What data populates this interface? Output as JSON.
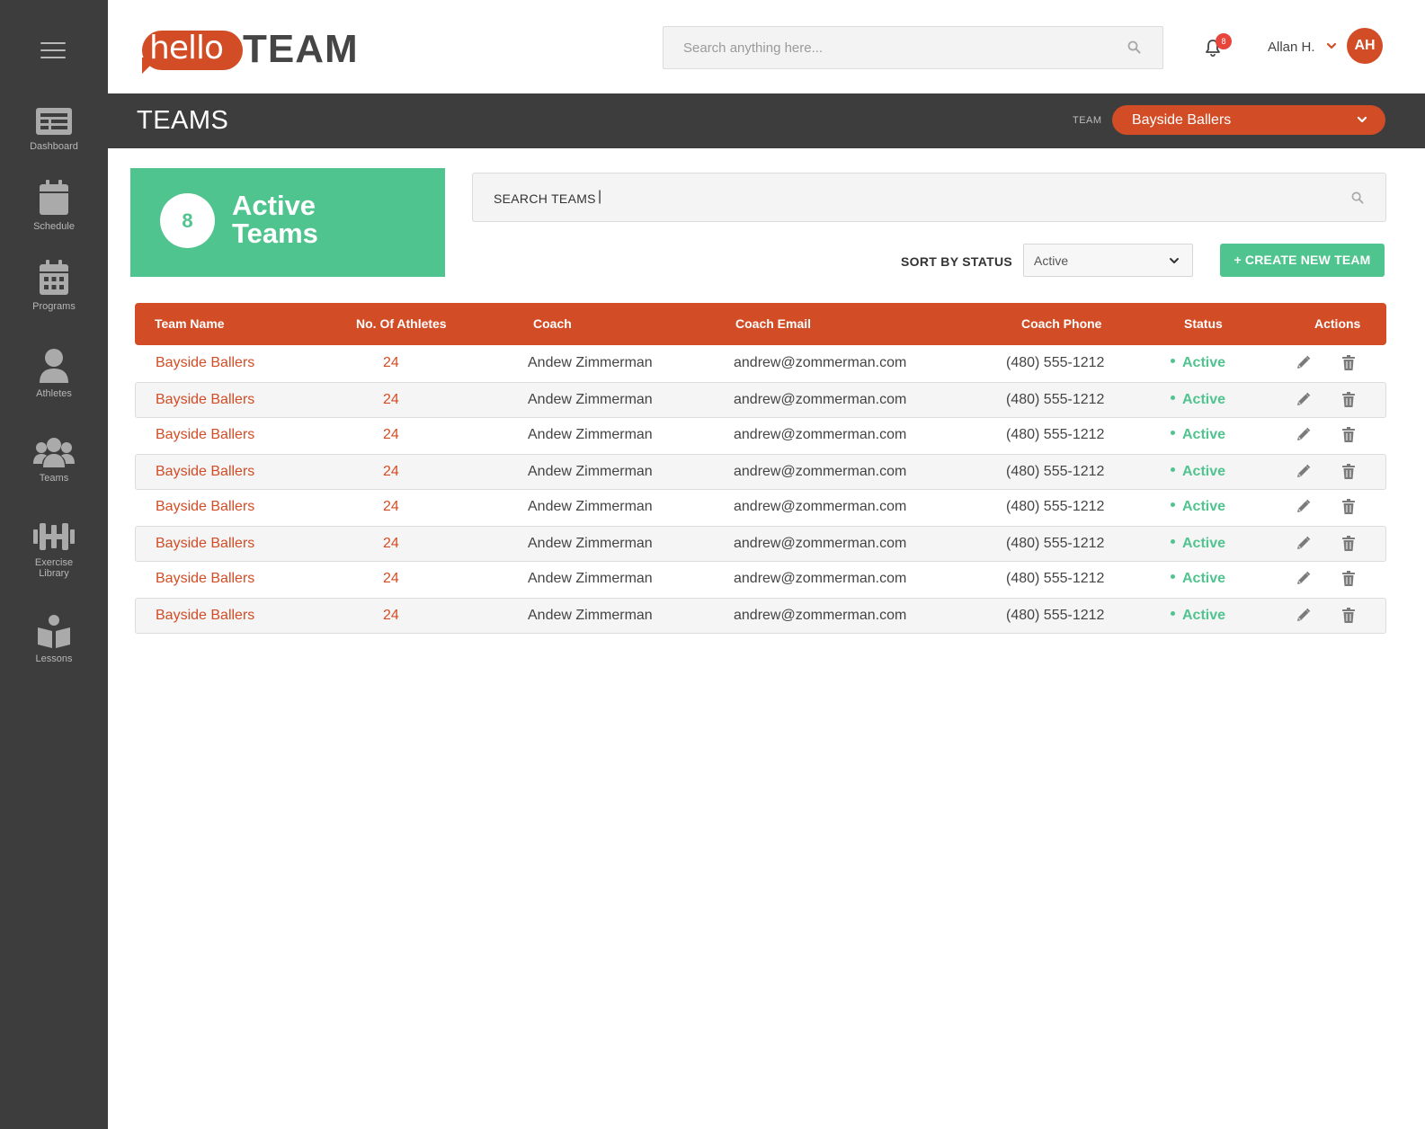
{
  "sidebar": {
    "items": [
      {
        "label": "Dashboard",
        "icon": "dashboard-icon"
      },
      {
        "label": "Schedule",
        "icon": "calendar-icon"
      },
      {
        "label": "Programs",
        "icon": "programs-calendar-icon"
      },
      {
        "label": "Athletes",
        "icon": "person-icon"
      },
      {
        "label": "Teams",
        "icon": "group-icon"
      },
      {
        "label": "Exercise Library",
        "icon": "dumbbell-icon"
      },
      {
        "label": "Lessons",
        "icon": "book-reader-icon"
      }
    ]
  },
  "header": {
    "logo_hello": "hello",
    "logo_team": "TEAM",
    "search_placeholder": "Search anything here...",
    "notification_count": "8",
    "user_name": "Allan H.",
    "avatar_initials": "AH"
  },
  "titlebar": {
    "title": "TEAMS",
    "team_label": "TEAM",
    "team_selected": "Bayside Ballers"
  },
  "stats": {
    "count": "8",
    "line1": "Active",
    "line2": "Teams"
  },
  "toolbar": {
    "search_label": "SEARCH TEAMS",
    "search_caret": "|",
    "sort_label": "SORT BY STATUS",
    "sort_value": "Active",
    "create_label": "+ CREATE NEW TEAM"
  },
  "table": {
    "columns": [
      "Team Name",
      "No. Of Athletes",
      "Coach",
      "Coach Email",
      "Coach Phone",
      "Status",
      "Actions"
    ],
    "rows": [
      {
        "name": "Bayside Ballers",
        "athletes": "24",
        "coach": "Andew Zimmerman",
        "email": "andrew@zommerman.com",
        "phone": "(480) 555-1212",
        "status": "Active"
      },
      {
        "name": "Bayside Ballers",
        "athletes": "24",
        "coach": "Andew Zimmerman",
        "email": "andrew@zommerman.com",
        "phone": "(480) 555-1212",
        "status": "Active"
      },
      {
        "name": "Bayside Ballers",
        "athletes": "24",
        "coach": "Andew Zimmerman",
        "email": "andrew@zommerman.com",
        "phone": "(480) 555-1212",
        "status": "Active"
      },
      {
        "name": "Bayside Ballers",
        "athletes": "24",
        "coach": "Andew Zimmerman",
        "email": "andrew@zommerman.com",
        "phone": "(480) 555-1212",
        "status": "Active"
      },
      {
        "name": "Bayside Ballers",
        "athletes": "24",
        "coach": "Andew Zimmerman",
        "email": "andrew@zommerman.com",
        "phone": "(480) 555-1212",
        "status": "Active"
      },
      {
        "name": "Bayside Ballers",
        "athletes": "24",
        "coach": "Andew Zimmerman",
        "email": "andrew@zommerman.com",
        "phone": "(480) 555-1212",
        "status": "Active"
      },
      {
        "name": "Bayside Ballers",
        "athletes": "24",
        "coach": "Andew Zimmerman",
        "email": "andrew@zommerman.com",
        "phone": "(480) 555-1212",
        "status": "Active"
      },
      {
        "name": "Bayside Ballers",
        "athletes": "24",
        "coach": "Andew Zimmerman",
        "email": "andrew@zommerman.com",
        "phone": "(480) 555-1212",
        "status": "Active"
      }
    ]
  },
  "colors": {
    "accent": "#d24d26",
    "success": "#50c48f",
    "sidebar": "#3d3d3e"
  }
}
